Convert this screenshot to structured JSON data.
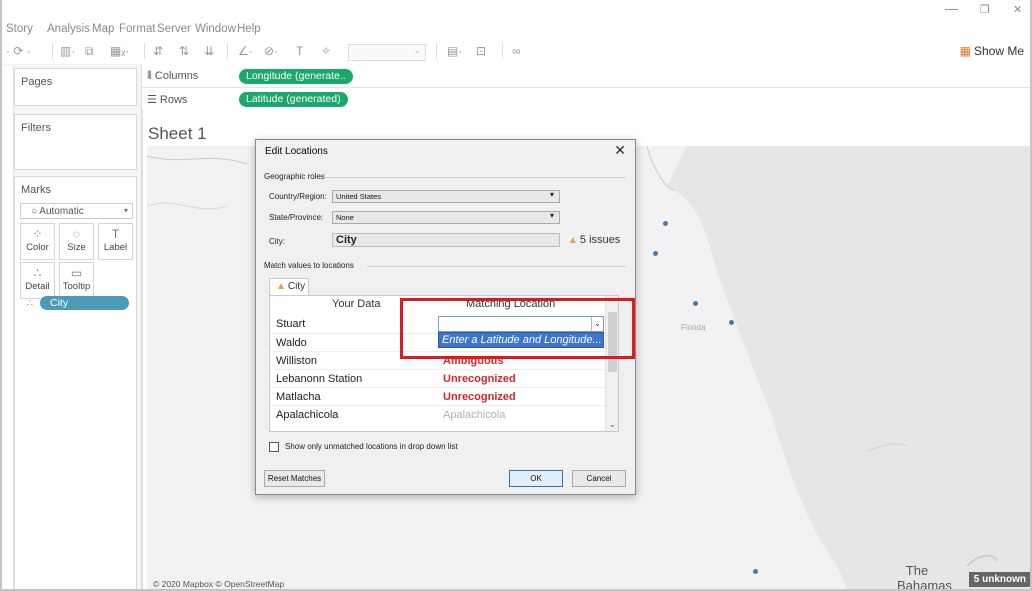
{
  "window": {
    "minimize": "—",
    "maximize": "❐",
    "close": "✕"
  },
  "menu": [
    "Story",
    "Analysis",
    "Map",
    "Format",
    "Server",
    "Window",
    "Help"
  ],
  "toolbar": {
    "show_me": "Show Me"
  },
  "panes": {
    "pages": "Pages",
    "filters": "Filters",
    "marks": "Marks"
  },
  "marks": {
    "type": "Automatic",
    "buttons": [
      "Color",
      "Size",
      "Label",
      "Detail",
      "Tooltip"
    ],
    "pill": "City"
  },
  "shelves": {
    "columns_label": "Columns",
    "columns_pill": "Longitude (generate..",
    "rows_label": "Rows",
    "rows_pill": "Latitude (generated)"
  },
  "sheet": {
    "title": "Sheet 1"
  },
  "map": {
    "state_label": "Florida",
    "credit": "© 2020 Mapbox © OpenStreetMap",
    "place_label": "The Bahamas",
    "unknown_badge": "5 unknown"
  },
  "dialog": {
    "title": "Edit Locations",
    "close": "✕",
    "geo_roles_label": "Geographic roles",
    "country_label": "Country/Region:",
    "country_value": "United States",
    "state_label": "State/Province:",
    "state_value": "None",
    "city_label": "City:",
    "city_value": "City",
    "issues": "5 issues",
    "match_label": "Match values to locations",
    "tab": "City",
    "col_your_data": "Your Data",
    "col_matching": "Matching Location",
    "rows": [
      {
        "data": "Stuart",
        "match": ""
      },
      {
        "data": "Waldo",
        "match": ""
      },
      {
        "data": "Williston",
        "match": "Ambiguous"
      },
      {
        "data": "Lebanonn Station",
        "match": "Unrecognized"
      },
      {
        "data": "Matlacha",
        "match": "Unrecognized"
      },
      {
        "data": "Apalachicola",
        "match": "Apalachicola"
      }
    ],
    "combo_option": "Enter a Latitude and Longitude...",
    "show_unmatched": "Show only unmatched locations in drop down list",
    "reset_button": "Reset Matches",
    "ok_button": "OK",
    "cancel_button": "Cancel"
  },
  "colors": {
    "pill_green": "#1ba96b",
    "pill_blue": "#4b9ab8",
    "map_dot": "#4e79a7",
    "error_red": "#d9252c",
    "highlight_box": "#e0181f",
    "selection_blue": "#3f75d1"
  }
}
